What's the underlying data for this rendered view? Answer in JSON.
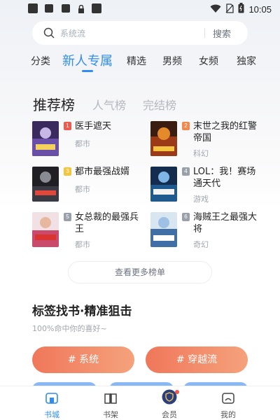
{
  "status_bar": {
    "time": "10:05",
    "icons": [
      "app-square-icon",
      "app-square-icon",
      "app-square-icon",
      "lock-icon",
      "app-square-icon",
      "wifi-icon",
      "no-sim-icon",
      "battery-icon"
    ]
  },
  "search": {
    "placeholder": "系统流",
    "button_label": "搜索"
  },
  "category_tabs": [
    "分类",
    "新人专属",
    "精选",
    "男频",
    "女频",
    "独家"
  ],
  "ranking_tabs": [
    "推荐榜",
    "人气榜",
    "完结榜"
  ],
  "books": [
    {
      "rank": "1",
      "title": "医手遮天",
      "genre": "都市",
      "badge_color": "#ee5a4e"
    },
    {
      "rank": "2",
      "title": "末世之我的红警帝国",
      "genre": "科幻",
      "badge_color": "#f0894b"
    },
    {
      "rank": "3",
      "title": "都市最强战婿",
      "genre": "都市",
      "badge_color": "#f4c53c"
    },
    {
      "rank": "4",
      "title": "LOL：我！赛场通天代",
      "genre": "游戏",
      "badge_color": "#9aa0aa"
    },
    {
      "rank": "5",
      "title": "女总裁的最强兵王",
      "genre": "都市",
      "badge_color": "#9aa0aa"
    },
    {
      "rank": "6",
      "title": "海贼王之最强大将",
      "genre": "奇幻",
      "badge_color": "#9aa0aa"
    }
  ],
  "more_button": "查看更多榜单",
  "tag_section": {
    "title": "标签找书·精准狙击",
    "subtitle": "100%命中你的喜好~",
    "tags": [
      "# 系统",
      "# 穿越流"
    ]
  },
  "bottom_nav": [
    {
      "label": "书城",
      "icon": "bookstore-icon",
      "active": true
    },
    {
      "label": "书架",
      "icon": "bookshelf-icon",
      "active": false
    },
    {
      "label": "会员",
      "icon": "vip-shield-icon",
      "active": false
    },
    {
      "label": "我的",
      "icon": "profile-icon",
      "active": false
    }
  ],
  "colors": {
    "accent": "#2f8cf0",
    "tag_gradient_start": "#f0775a",
    "tag_gradient_end": "#f5a27c"
  }
}
